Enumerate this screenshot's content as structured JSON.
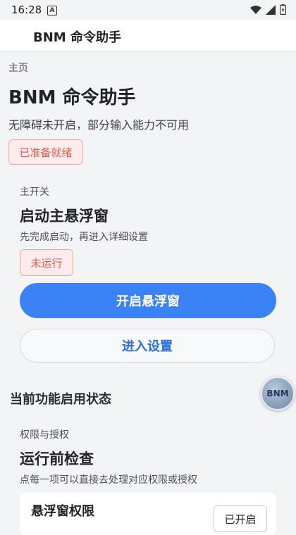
{
  "status_bar": {
    "time": "16:28",
    "notif_glyph": "A",
    "icons": [
      "wifi-icon",
      "signal-icon",
      "battery-icon"
    ]
  },
  "app_bar": {
    "title": "BNM 命令助手"
  },
  "breadcrumb": "主页",
  "page": {
    "title": "BNM 命令助手",
    "subtitle": "无障碍未开启，部分输入能力不可用",
    "ready_badge": "已准备就绪"
  },
  "main_switch": {
    "label": "主开关",
    "title": "启动主悬浮窗",
    "desc": "先完成启动，再进入详细设置",
    "status_badge": "未运行",
    "primary_button": "开启悬浮窗",
    "settings_button": "进入设置"
  },
  "feature_section": {
    "heading": "当前功能启用状态"
  },
  "permissions": {
    "label": "权限与授权",
    "title": "运行前检查",
    "desc": "点每一项可以直接去处理对应权限或授权",
    "items": [
      {
        "name": "悬浮窗权限",
        "state": "已开启"
      }
    ]
  },
  "floating_bubble": {
    "text": "BNM"
  },
  "colors": {
    "accent": "#3b82f6",
    "danger_text": "#d85b52",
    "danger_bg": "#fdeceb"
  }
}
